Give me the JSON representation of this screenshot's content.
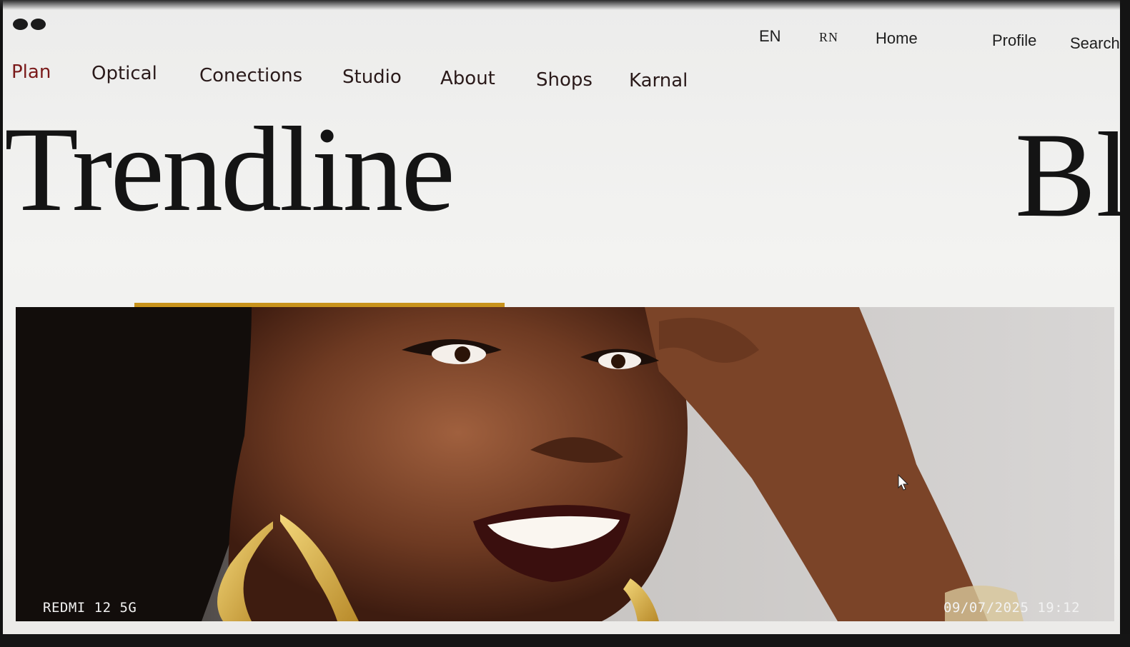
{
  "header": {
    "logo_icon": "two-dots-logo-icon",
    "utility_nav": [
      {
        "label": "EN"
      },
      {
        "label": "RN"
      },
      {
        "label": "Home"
      },
      {
        "label": "Profile"
      },
      {
        "label": "Search"
      }
    ]
  },
  "main_nav": [
    {
      "label": "Plan",
      "active": true
    },
    {
      "label": "Optical"
    },
    {
      "label": "Conections"
    },
    {
      "label": "Studio"
    },
    {
      "label": "About"
    },
    {
      "label": "Shops"
    },
    {
      "label": "Karnal"
    }
  ],
  "hero": {
    "title": "Trendline",
    "title_secondary": "Bl",
    "image": "portrait-smiling-woman-gold-earrings",
    "accent_color": "#c8931c"
  },
  "photo_overlay": {
    "device": "REDMI 12 5G",
    "timestamp": "09/07/2025  19:12"
  },
  "colors": {
    "active_nav": "#7a1a1a",
    "text": "#1e1e1e",
    "background": "#efefed"
  }
}
